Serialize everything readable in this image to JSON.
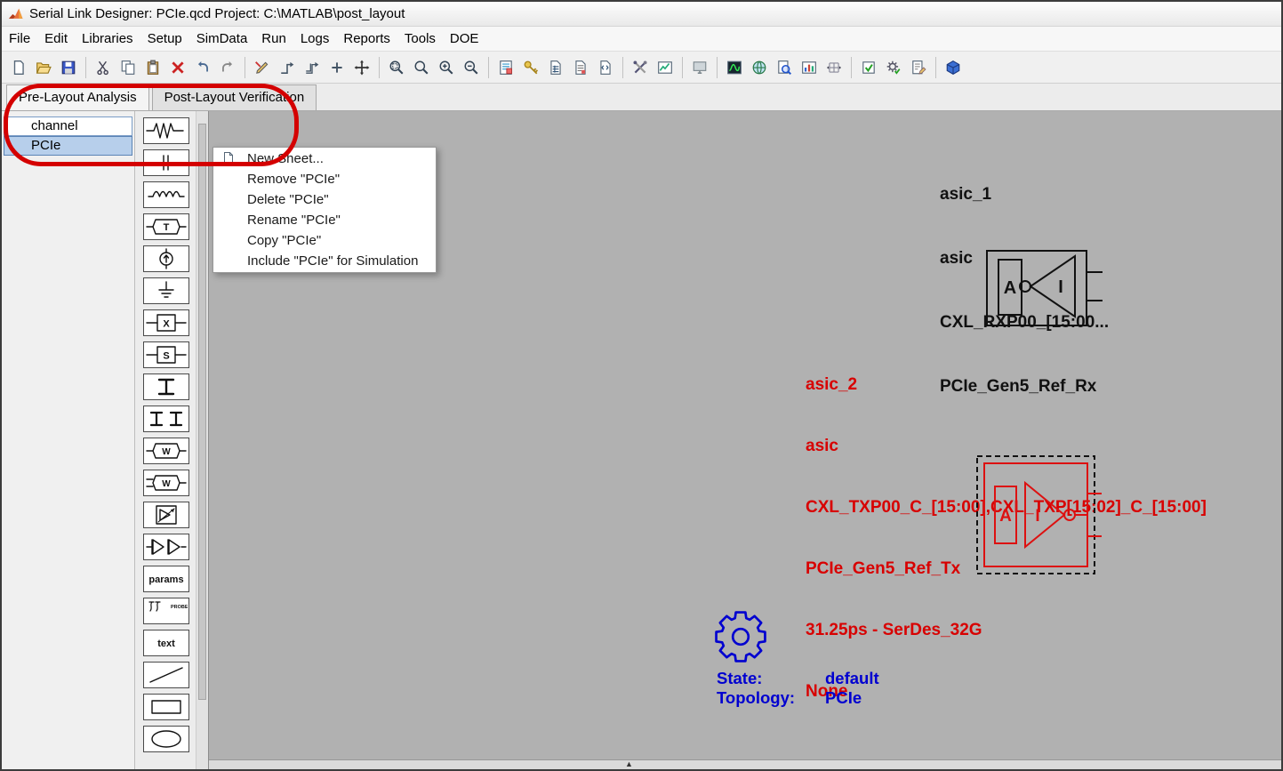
{
  "window": {
    "title": "Serial Link Designer: PCIe.qcd Project: C:\\MATLAB\\post_layout"
  },
  "menu": {
    "items": [
      "File",
      "Edit",
      "Libraries",
      "Setup",
      "SimData",
      "Run",
      "Logs",
      "Reports",
      "Tools",
      "DOE"
    ]
  },
  "toolbar": {
    "icons": [
      "new-sheet",
      "open-project",
      "save",
      "cut",
      "copy",
      "paste",
      "delete",
      "undo",
      "redo",
      "draw-tool",
      "connect-net",
      "connect-bus",
      "add-vertex",
      "move-tool",
      "zoom-area",
      "zoom-fit",
      "zoom-in",
      "zoom-out",
      "sheet-settings",
      "wizard-key",
      "doc-spreadsheet",
      "doc-report",
      "doc-log",
      "run-simulation",
      "view-results",
      "display-monitor",
      "waveform-viewer",
      "web-export",
      "inspect-doc",
      "chart-report",
      "constraint-mesh",
      "validate-sheet",
      "gear-task",
      "edit-report",
      "matlab-link"
    ]
  },
  "tabs": {
    "items": [
      {
        "label": "Pre-Layout Analysis",
        "active": true
      },
      {
        "label": "Post-Layout Verification",
        "active": false
      }
    ]
  },
  "sheets": {
    "items": [
      {
        "label": "channel",
        "selected": false
      },
      {
        "label": "PCIe",
        "selected": true
      }
    ]
  },
  "palette": {
    "items": [
      "resistor",
      "capacitor",
      "inductor",
      "t-element",
      "current-source",
      "ground",
      "x-block",
      "s-block",
      "coupled-line",
      "dual-coupled-line",
      "w-element",
      "w-element-coupled",
      "buffer-block",
      "diff-buffer",
      "params",
      "probes",
      "text",
      "line",
      "rectangle",
      "ellipse"
    ]
  },
  "context_menu": {
    "items": [
      "New Sheet...",
      "Remove \"PCIe\"",
      "Delete \"PCIe\"",
      "Rename \"PCIe\"",
      "Copy \"PCIe\"",
      "Include \"PCIe\" for Simulation"
    ]
  },
  "canvas": {
    "asic1": {
      "lines": [
        "asic_1",
        "asic",
        "CXL_RXP00_[15:00...",
        "PCIe_Gen5_Ref_Rx"
      ]
    },
    "asic2": {
      "lines": [
        "asic_2",
        "asic",
        "CXL_TXP00_C_[15:00],CXL_TXP[15:02]_C_[15:00]",
        "PCIe_Gen5_Ref_Tx",
        "31.25ps - SerDes_32G",
        "None"
      ]
    },
    "state_label": "State:",
    "state_value": "default",
    "topology_label": "Topology:",
    "topology_value": "PCIe"
  },
  "colors": {
    "canvas_bg": "#b1b1b1",
    "annotation": "#d40000",
    "symbol_red": "#dd1111",
    "symbol_black": "#111111",
    "text_blue": "#0000d0",
    "selected_row": "#b7cfeb"
  }
}
